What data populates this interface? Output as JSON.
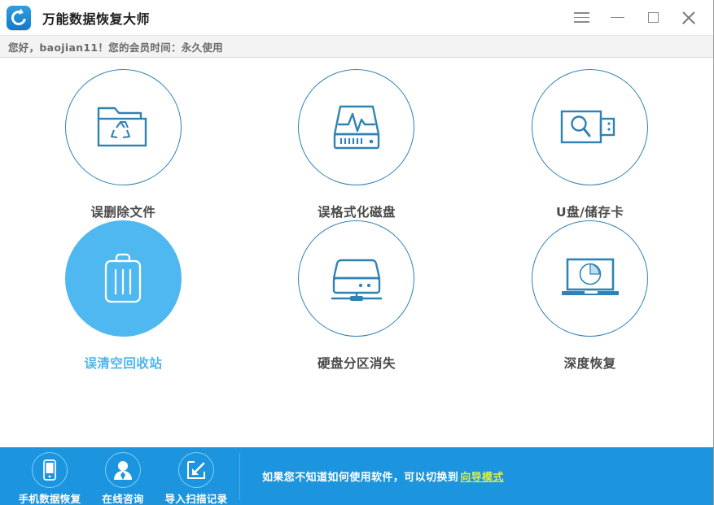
{
  "window": {
    "title": "万能数据恢复大师",
    "logo_icon": "refresh-circle-logo-icon",
    "controls": [
      {
        "name": "menu",
        "icon": "hamburger-icon",
        "label": ""
      },
      {
        "name": "minimize",
        "icon": "minimize-icon",
        "label": ""
      },
      {
        "name": "maximize",
        "icon": "maximize-icon",
        "label": ""
      },
      {
        "name": "close",
        "icon": "close-icon",
        "label": ""
      }
    ]
  },
  "greeting": {
    "text": "您好，baojian11！您的会员时间：永久使用"
  },
  "recovery_modes": [
    {
      "label": "误删除文件",
      "icon": "folder-recycle-icon",
      "selected": false
    },
    {
      "label": "误格式化磁盘",
      "icon": "disk-pulse-icon",
      "selected": false
    },
    {
      "label": "U盘/储存卡",
      "icon": "usb-search-icon",
      "selected": false
    },
    {
      "label": "误清空回收站",
      "icon": "trash-can-icon",
      "selected": true
    },
    {
      "label": "硬盘分区消失",
      "icon": "disk-network-icon",
      "selected": false
    },
    {
      "label": "深度恢复",
      "icon": "laptop-scan-icon",
      "selected": false
    }
  ],
  "bottombar": {
    "actions": [
      {
        "label": "手机数据恢复",
        "icon": "mobile-phone-icon"
      },
      {
        "label": "在线咨询",
        "icon": "user-avatar-icon"
      },
      {
        "label": "导入扫描记录",
        "icon": "import-arrow-icon"
      }
    ],
    "hint_prefix": "如果您不知道如何使用软件，可以切换到",
    "hint_link": "向导模式"
  },
  "colors": {
    "accent": "#1c95de",
    "outline_blue": "#2f83b4",
    "selected_blue": "#4fb8f0",
    "link_yellow": "#d8ed51",
    "label_gray": "#4a4a4a"
  }
}
